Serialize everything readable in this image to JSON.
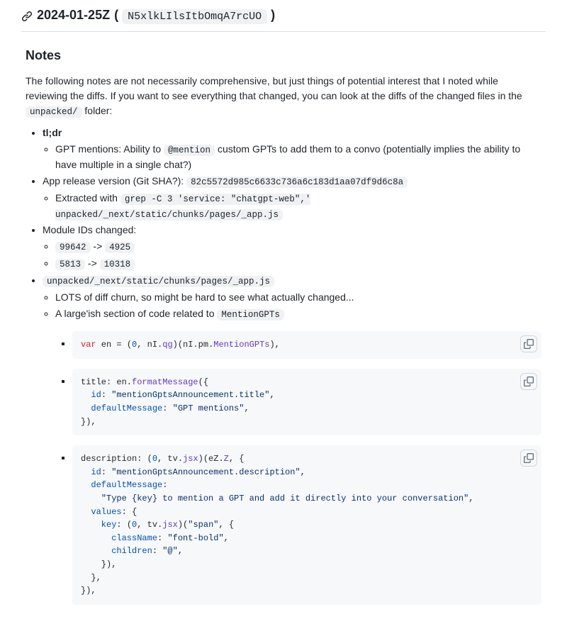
{
  "header": {
    "date": "2024-01-25Z",
    "open_paren": " ( ",
    "build_id": "N5xlkLIlsItbOmqA7rcUO",
    "close_paren": " )"
  },
  "notes": {
    "title": "Notes",
    "intro_pre": "The following notes are not necessarily comprehensive, but just things of potential interest that I noted while reviewing the diffs. If you want to see everything that changed, you can look at the diffs of the changed files in the ",
    "intro_code": "unpacked/",
    "intro_post": " folder:"
  },
  "tldr": {
    "label": "tl;dr",
    "gpt_mentions_pre": "GPT mentions: Ability to ",
    "gpt_mentions_code": "@mention",
    "gpt_mentions_post": " custom GPTs to add them to a convo (potentially implies the ability to have multiple in a single chat?)"
  },
  "app_release": {
    "label": "App release version (Git SHA?): ",
    "sha": "82c5572d985c6633c736a6c183d1aa07df9d6c8a",
    "extracted_label": "Extracted with ",
    "extracted_cmd": "grep -C 3 'service: \"chatgpt-web\",' unpacked/_next/static/chunks/pages/_app.js"
  },
  "module_ids": {
    "label": "Module IDs changed:",
    "row1_a": "99642",
    "arrow": " -> ",
    "row1_b": "4925",
    "row2_a": "5813",
    "row2_b": "10318"
  },
  "appjs": {
    "path": "unpacked/_next/static/chunks/pages/_app.js",
    "line1": "LOTS of diff churn, so might be hard to see what actually changed...",
    "line2_pre": "A large'ish section of code related to ",
    "line2_code": "MentionGPTs"
  },
  "code1": {
    "var_kw": "var",
    "rest_a": " en = (",
    "zero": "0",
    "rest_b": ", nI.",
    "qg": "qg",
    "rest_c": ")(nI.pm.",
    "mg": "MentionGPTs",
    "rest_d": "),"
  },
  "code2": {
    "l1a": "title: en.",
    "l1b": "formatMessage",
    "l1c": "({",
    "l2a": "  id",
    "l2b": ": ",
    "l2c": "\"mentionGptsAnnouncement.title\"",
    "l2d": ",",
    "l3a": "  defaultMessage",
    "l3b": ": ",
    "l3c": "\"GPT mentions\"",
    "l3d": ",",
    "l4": "}),"
  },
  "code3": {
    "l1a": "description: (",
    "zero": "0",
    "l1b": ", tv.",
    "jsx": "jsx",
    "l1c": ")(eZ.",
    "Z": "Z",
    "l1d": ", {",
    "l2a": "  id",
    "colon": ": ",
    "l2c": "\"mentionGptsAnnouncement.description\"",
    "comma": ",",
    "l3a": "  defaultMessage",
    "l3b": ":",
    "l4a": "    ",
    "l4b": "\"Type {key} to mention a GPT and add it directly into your conversation\"",
    "l5a": "  values",
    "l5b": ": {",
    "l6a": "    key",
    "l6b": ": (",
    "l6c": ", tv.",
    "l6d": ")(",
    "l6e": "\"span\"",
    "l6f": ", {",
    "l7a": "      className",
    "l7b": "\"font-bold\"",
    "l8a": "      children",
    "l8b": "\"@\"",
    "l9": "    }),",
    "l10": "  },",
    "l11": "}),"
  }
}
